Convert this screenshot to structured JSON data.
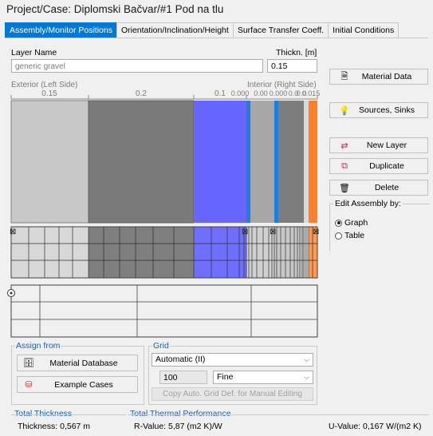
{
  "title": "Project/Case:  Diplomski Bačvar/#1 Pod na tlu",
  "tabs": [
    {
      "label": "Assembly/Monitor Positions",
      "active": true
    },
    {
      "label": "Orientation/Inclination/Height",
      "active": false
    },
    {
      "label": "Surface Transfer Coeff.",
      "active": false
    },
    {
      "label": "Initial Conditions",
      "active": false
    }
  ],
  "layer": {
    "name_label": "Layer Name",
    "name_value": "generic gravel",
    "thick_label": "Thickn. [m]",
    "thick_value": "0.15"
  },
  "ruler": {
    "exterior": "Exterior (Left Side)",
    "interior": "Interior (Right Side)",
    "ticks": [
      "0.15",
      "0.2",
      "0.1",
      "0.000",
      "0.00",
      "0.000",
      "0.0",
      "0.0",
      "0.015"
    ]
  },
  "buttons": {
    "material_data": "Material Data",
    "sources_sinks": "Sources, Sinks",
    "new_layer": "New Layer",
    "duplicate": "Duplicate",
    "delete": "Delete"
  },
  "edit_assembly": {
    "title": "Edit Assembly by:",
    "graph": "Graph",
    "table": "Table",
    "selected": "graph"
  },
  "assign_from": {
    "title": "Assign from",
    "material_database": "Material Database",
    "example_cases": "Example Cases"
  },
  "grid": {
    "title": "Grid",
    "mode": "Automatic (II)",
    "count": "100",
    "fineness": "Fine",
    "copy_button": "Copy Auto. Grid Def. for Manual Editing"
  },
  "footer": {
    "total_thickness_title": "Total Thickness",
    "thickness": "Thickness: 0,567 m",
    "thermal_title": "Total Thermal Performance",
    "r_value": "R-Value: 5,87 (m2 K)/W",
    "u_value": "U-Value: 0,167 W/(m2 K)"
  },
  "colors": {
    "accent": "#0078d7",
    "layer_gravel": "#c8c8c8",
    "layer_concrete": "#7a7a7a",
    "layer_insulation": "#6666ff",
    "layer_thin_blue": "#1e7fe0",
    "layer_screed": "#a7a7a7",
    "layer_finish": "#ff7f27"
  }
}
